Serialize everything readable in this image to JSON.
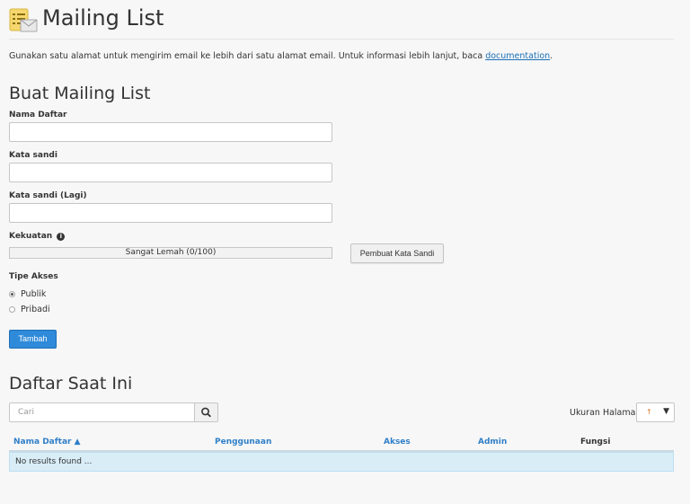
{
  "header": {
    "title": "Mailing List",
    "intro_text": "Gunakan satu alamat untuk mengirim email ke lebih dari satu alamat email. Untuk informasi lebih lanjut, baca ",
    "intro_link": "documentation",
    "intro_end": ".",
    "icon": "mailing-list-icon"
  },
  "create_form": {
    "title": "Buat Mailing List",
    "list_name_label": "Nama Daftar",
    "list_name_value": "",
    "password_label": "Kata sandi",
    "password_value": "",
    "password_again_label": "Kata sandi (Lagi)",
    "password_again_value": "",
    "strength_label": "Kekuatan",
    "strength_text": "Sangat Lemah (0/100)",
    "strength_value": 0,
    "generator_button": "Pembuat Kata Sandi",
    "access_type_label": "Tipe Akses",
    "access_options": [
      {
        "label": "Publik",
        "selected": true
      },
      {
        "label": "Pribadi",
        "selected": false
      }
    ],
    "add_button": "Tambah"
  },
  "current_lists": {
    "title": "Daftar Saat Ini",
    "search_placeholder": "Cari",
    "page_size_label": "Ukuran Halaman",
    "page_size_value": "↑",
    "columns": [
      {
        "label": "Nama Daftar ▲",
        "sortable": true
      },
      {
        "label": "Penggunaan",
        "sortable": true
      },
      {
        "label": "Akses",
        "sortable": true
      },
      {
        "label": "Admin",
        "sortable": true
      },
      {
        "label": "Fungsi",
        "sortable": false
      }
    ],
    "empty_message": "No results found ..."
  },
  "colors": {
    "primary": "#2f8ad9",
    "link": "#1a6fb5",
    "empty_row_bg": "#d9edf7"
  }
}
